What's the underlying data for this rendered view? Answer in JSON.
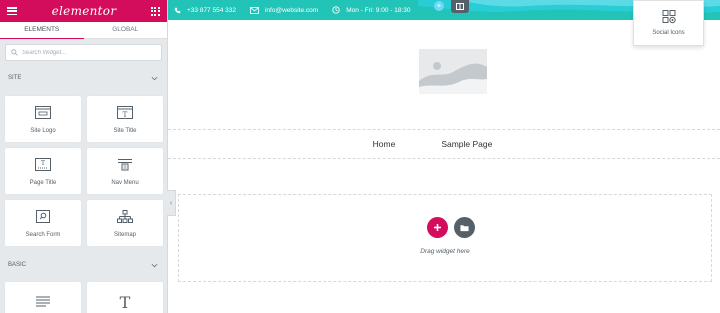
{
  "app": {
    "logo_text": "elementor"
  },
  "sidebar": {
    "tabs": [
      {
        "label": "ELEMENTS",
        "active": true
      },
      {
        "label": "GLOBAL",
        "active": false
      }
    ],
    "search": {
      "placeholder": "Search Widget...",
      "value": ""
    },
    "sections": {
      "site": {
        "title": "SITE",
        "widgets": [
          {
            "label": "Site Logo",
            "icon": "site-logo-icon"
          },
          {
            "label": "Site Title",
            "icon": "site-title-icon"
          },
          {
            "label": "Page Title",
            "icon": "page-title-icon"
          },
          {
            "label": "Nav Menu",
            "icon": "nav-menu-icon"
          },
          {
            "label": "Search Form",
            "icon": "search-form-icon"
          },
          {
            "label": "Sitemap",
            "icon": "sitemap-icon"
          }
        ]
      },
      "basic": {
        "title": "BASIC",
        "widgets": [
          {
            "label": "",
            "icon": "text-editor-icon"
          },
          {
            "label": "",
            "icon": "heading-icon"
          }
        ]
      }
    },
    "collapse_glyph": "‹"
  },
  "topbar": {
    "phone": "+33 877 554 332",
    "email": "info@website.com",
    "hours": "Mon - Fri: 9:00 - 18:30",
    "color": "#23c4b8"
  },
  "drag_widget": {
    "label": "Social Icons",
    "icon": "social-icons-icon"
  },
  "canvas": {
    "nav_links": [
      "Home",
      "Sample Page"
    ],
    "drop_zone_text": "Drag widget here"
  },
  "colors": {
    "accent": "#d30c5c",
    "teal": "#23c4b8",
    "dark": "#556068"
  }
}
